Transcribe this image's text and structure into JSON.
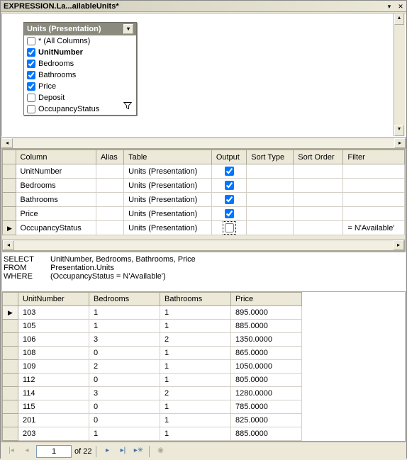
{
  "title": "EXPRESSION.La...ailableUnits*",
  "diagram": {
    "title": "Units (Presentation)",
    "items": [
      {
        "label": "* (All Columns)",
        "checked": false,
        "bold": false
      },
      {
        "label": "UnitNumber",
        "checked": true,
        "bold": true
      },
      {
        "label": "Bedrooms",
        "checked": true,
        "bold": false
      },
      {
        "label": "Bathrooms",
        "checked": true,
        "bold": false
      },
      {
        "label": "Price",
        "checked": true,
        "bold": false
      },
      {
        "label": "Deposit",
        "checked": false,
        "bold": false
      },
      {
        "label": "OccupancyStatus",
        "checked": false,
        "bold": false
      }
    ]
  },
  "criteria": {
    "headers": {
      "column": "Column",
      "alias": "Alias",
      "table": "Table",
      "output": "Output",
      "sortType": "Sort Type",
      "sortOrder": "Sort Order",
      "filter": "Filter"
    },
    "rows": [
      {
        "column": "UnitNumber",
        "alias": "",
        "table": "Units (Presentation)",
        "output": true,
        "sortType": "",
        "sortOrder": "",
        "filter": ""
      },
      {
        "column": "Bedrooms",
        "alias": "",
        "table": "Units (Presentation)",
        "output": true,
        "sortType": "",
        "sortOrder": "",
        "filter": ""
      },
      {
        "column": "Bathrooms",
        "alias": "",
        "table": "Units (Presentation)",
        "output": true,
        "sortType": "",
        "sortOrder": "",
        "filter": ""
      },
      {
        "column": "Price",
        "alias": "",
        "table": "Units (Presentation)",
        "output": true,
        "sortType": "",
        "sortOrder": "",
        "filter": ""
      },
      {
        "column": "OccupancyStatus",
        "alias": "",
        "table": "Units (Presentation)",
        "output": false,
        "sortType": "",
        "sortOrder": "",
        "filter": "= N'Available'"
      }
    ],
    "activeRow": 4
  },
  "sql": {
    "kw_select": "SELECT",
    "sel": "UnitNumber, Bedrooms, Bathrooms, Price",
    "kw_from": "FROM",
    "from": "Presentation.Units",
    "kw_where": "WHERE",
    "where": "(OccupancyStatus = N'Available')"
  },
  "results": {
    "headers": {
      "c0": "UnitNumber",
      "c1": "Bedrooms",
      "c2": "Bathrooms",
      "c3": "Price"
    },
    "rows": [
      {
        "c0": "103",
        "c1": "1",
        "c2": "1",
        "c3": "895.0000"
      },
      {
        "c0": "105",
        "c1": "1",
        "c2": "1",
        "c3": "885.0000"
      },
      {
        "c0": "106",
        "c1": "3",
        "c2": "2",
        "c3": "1350.0000"
      },
      {
        "c0": "108",
        "c1": "0",
        "c2": "1",
        "c3": "865.0000"
      },
      {
        "c0": "109",
        "c1": "2",
        "c2": "1",
        "c3": "1050.0000"
      },
      {
        "c0": "112",
        "c1": "0",
        "c2": "1",
        "c3": "805.0000"
      },
      {
        "c0": "114",
        "c1": "3",
        "c2": "2",
        "c3": "1280.0000"
      },
      {
        "c0": "115",
        "c1": "0",
        "c2": "1",
        "c3": "785.0000"
      },
      {
        "c0": "201",
        "c1": "0",
        "c2": "1",
        "c3": "825.0000"
      },
      {
        "c0": "203",
        "c1": "1",
        "c2": "1",
        "c3": "885.0000"
      }
    ],
    "activeRow": 0
  },
  "nav": {
    "current": "1",
    "of": "of 22"
  }
}
